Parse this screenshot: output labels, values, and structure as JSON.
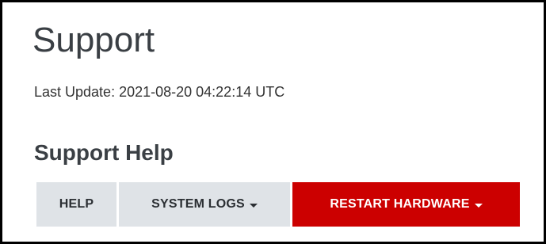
{
  "page": {
    "title": "Support",
    "last_update": "Last Update: 2021-08-20 04:22:14 UTC"
  },
  "section": {
    "title": "Support Help"
  },
  "toolbar": {
    "help_label": "HELP",
    "system_logs_label": "SYSTEM LOGS",
    "restart_hardware_label": "RESTART HARDWARE",
    "help_icon": "none",
    "dropdown_icon": "chevron-down-icon"
  },
  "colors": {
    "title_text": "#3a3f44",
    "secondary_button_bg": "#dfe3e7",
    "danger_button_bg": "#cc0000",
    "frame_border": "#000000"
  }
}
